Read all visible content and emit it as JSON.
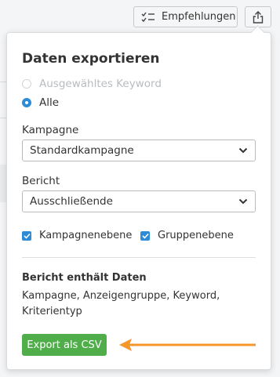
{
  "toolbar": {
    "recommendations_label": "Empfehlungen",
    "recommendations_icon": "checklist-icon",
    "export_icon": "share-export-icon"
  },
  "popover": {
    "title": "Daten exportieren",
    "radios": [
      {
        "label": "Ausgewähltes Keyword",
        "checked": false,
        "disabled": true
      },
      {
        "label": "Alle",
        "checked": true,
        "disabled": false
      }
    ],
    "campaign": {
      "label": "Kampagne",
      "value": "Standardkampagne"
    },
    "report": {
      "label": "Bericht",
      "value": "Ausschließende"
    },
    "checkboxes": [
      {
        "label": "Kampagnenebene",
        "checked": true
      },
      {
        "label": "Gruppenebene",
        "checked": true
      }
    ],
    "info": {
      "title": "Bericht enthält Daten",
      "body": "Kampagne, Anzeigengruppe, Keyword, Kriterientyp"
    },
    "export_button_label": "Export als CSV"
  },
  "colors": {
    "accent_blue": "#2e8bd6",
    "button_green": "#4fae4a",
    "annotation_orange": "#f5962f"
  }
}
